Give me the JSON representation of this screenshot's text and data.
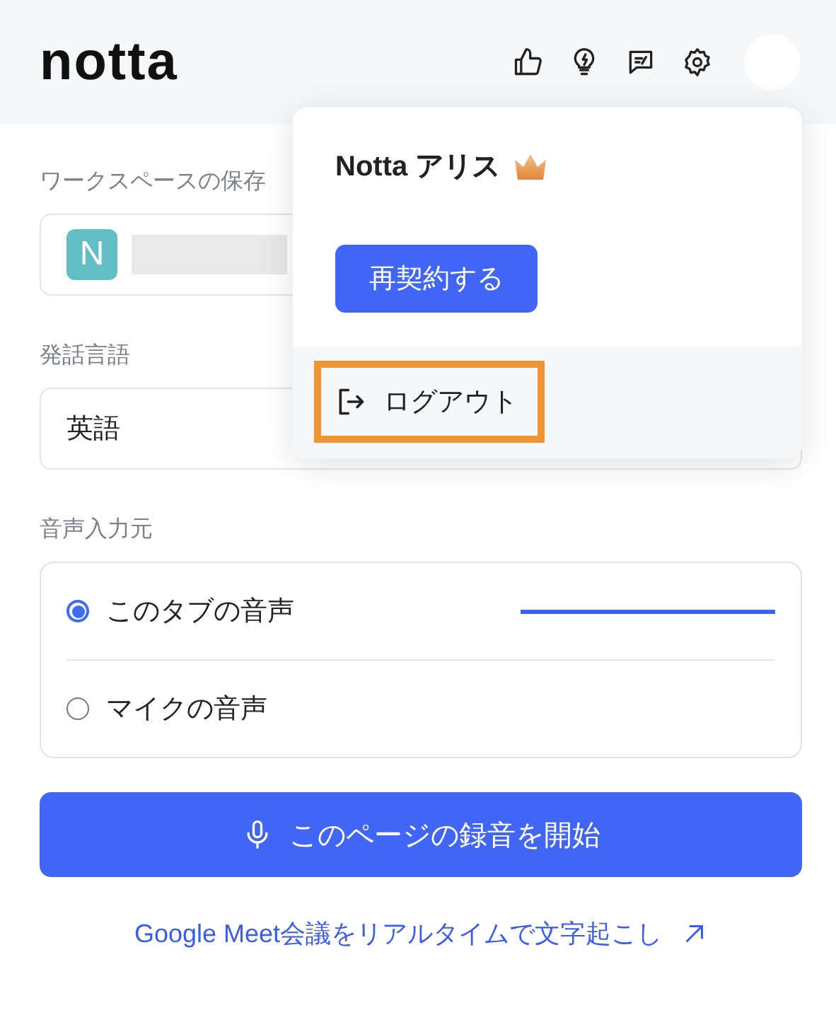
{
  "header": {
    "logo": "notta"
  },
  "workspace": {
    "label": "ワークスペースの保存",
    "badge": "N"
  },
  "language": {
    "label": "発話言語",
    "value": "英語"
  },
  "audio_source": {
    "label": "音声入力元",
    "options": [
      {
        "label": "このタブの音声",
        "selected": true
      },
      {
        "label": "マイクの音声",
        "selected": false
      }
    ]
  },
  "record_button": "このページの録音を開始",
  "link": "Google Meet会議をリアルタイムで文字起こし",
  "account_menu": {
    "name": "Notta アリス",
    "renew_button": "再契約する",
    "logout": {
      "label": "ログアウト",
      "highlighted": true
    }
  }
}
